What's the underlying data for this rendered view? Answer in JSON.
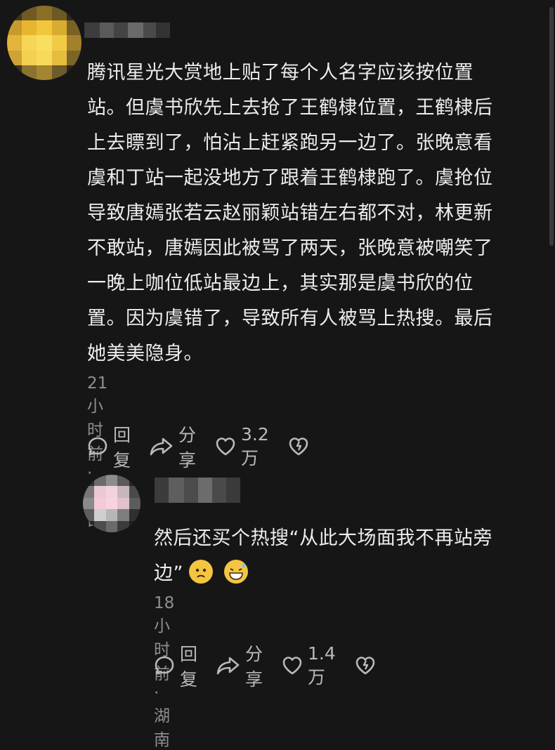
{
  "comments": [
    {
      "text": "腾讯星光大赏地上贴了每个人名字应该按位置\n站。但虞书欣先上去抢了王鹤棣位置，王鹤棣后\n上去瞟到了，怕沾上赶紧跑另一边了。张晚意看\n虞和丁站一起没地方了跟着王鹤棣跑了。虞抢位\n导致唐嫣张若云赵丽颖站错左右都不对，林更新\n不敢站，唐嫣因此被骂了两天，张晚意被嘲笑了\n一晚上咖位低站最边上，其实那是虞书欣的位\n置。因为虞错了，导致所有人被骂上热搜。最后\n她美美隐身。",
      "meta": "21小时前 · 陕西",
      "reply_label": "回复",
      "share_label": "分享",
      "like_count": "3.2万"
    },
    {
      "text_line1": "然后还买个热搜“从此大场面我不再站旁",
      "text_line2_prefix": "边”",
      "meta": "18小时前 · 湖南",
      "reply_label": "回复",
      "share_label": "分享",
      "like_count": "1.4万"
    }
  ],
  "icons": {
    "reply": "speech-bubble-icon",
    "share": "share-arrow-icon",
    "like": "heart-icon",
    "dislike": "broken-heart-icon"
  },
  "colors": {
    "background": "#161616",
    "text": "#ececec",
    "meta": "#8f8f8f",
    "action": "#b9b9b9",
    "emoji": "#f5c542"
  }
}
